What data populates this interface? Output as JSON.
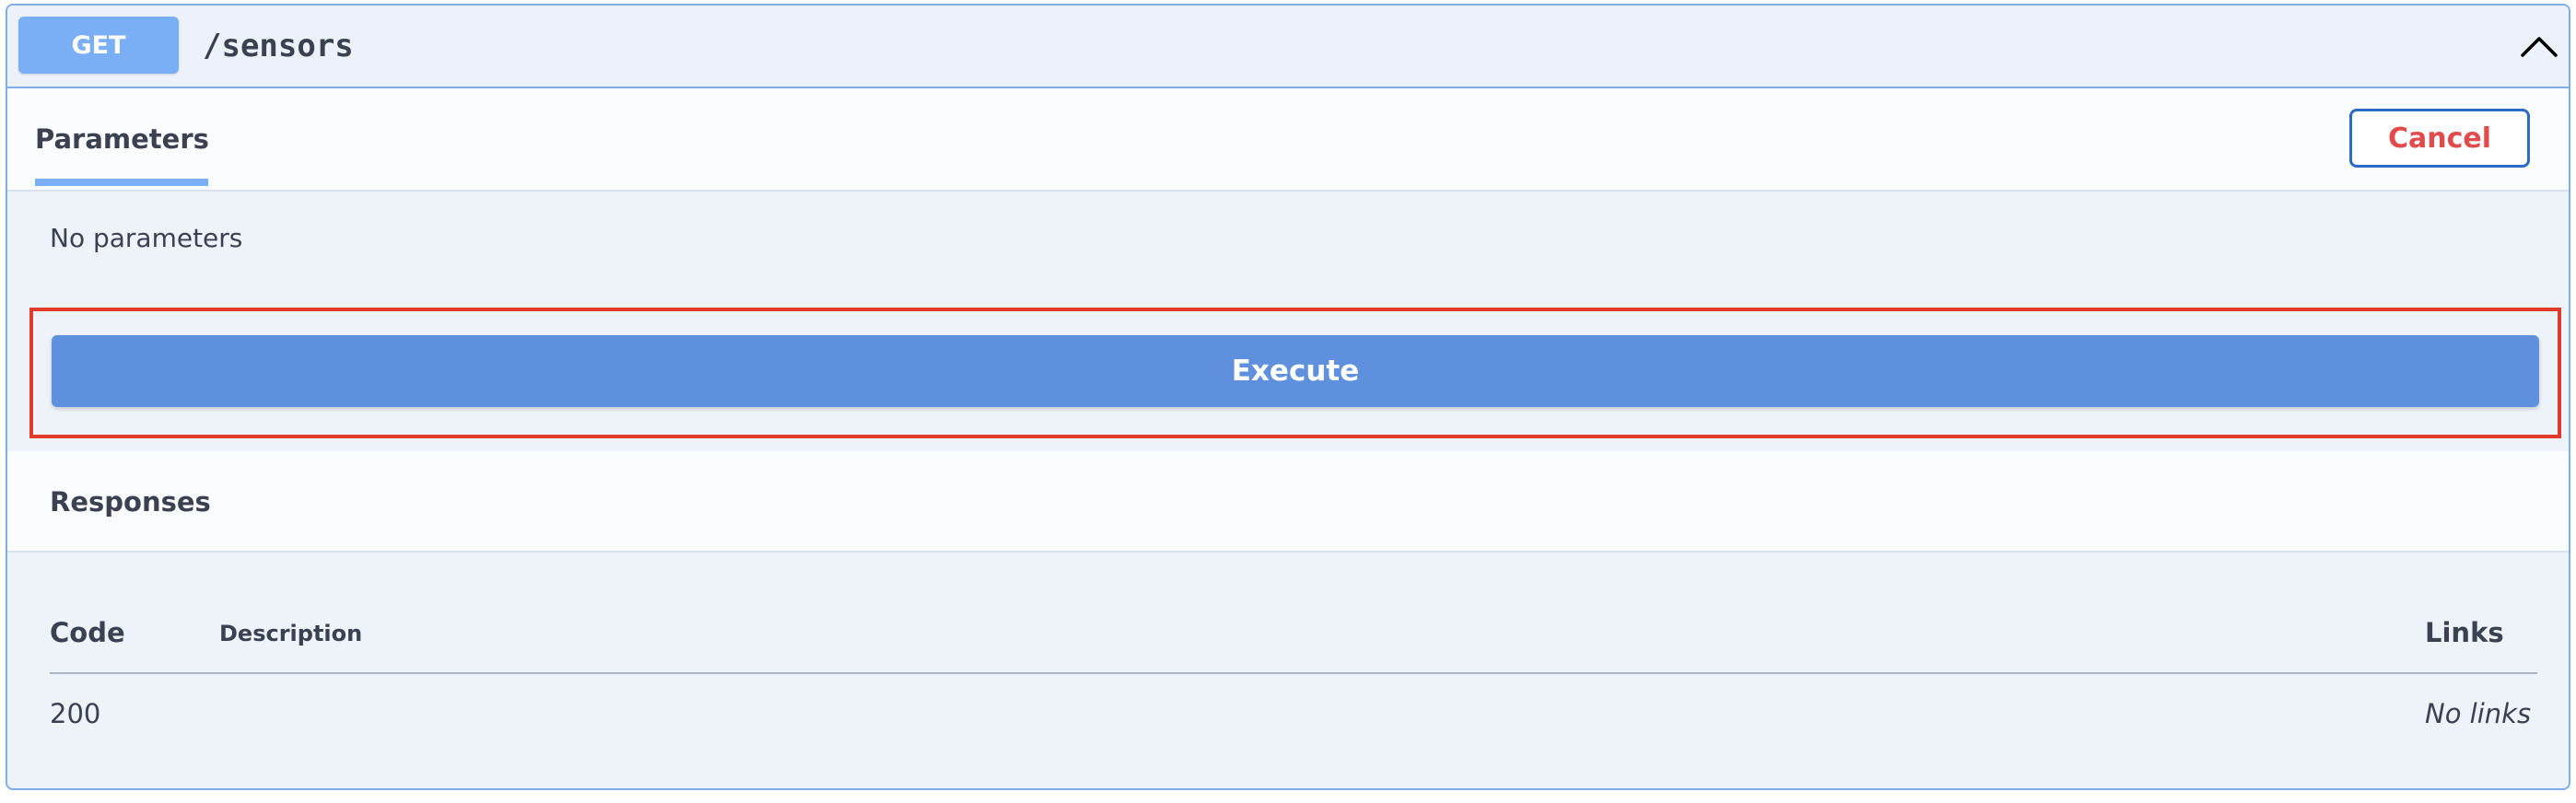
{
  "summary": {
    "method": "GET",
    "path": "/sensors",
    "chevron_icon": "chevron-up-icon"
  },
  "parameters": {
    "tab_label": "Parameters",
    "cancel_label": "Cancel",
    "empty_text": "No parameters"
  },
  "execute": {
    "label": "Execute"
  },
  "responses": {
    "title": "Responses",
    "columns": {
      "code": "Code",
      "description": "Description",
      "links": "Links"
    },
    "rows": [
      {
        "code": "200",
        "description": "",
        "links": "No links"
      }
    ]
  },
  "colors": {
    "method_badge": "#7aaff5",
    "execute_button": "#5e90dd",
    "cancel_text": "#e14b4b",
    "cancel_border": "#2d6bc9",
    "highlight_box": "#e03a2b",
    "block_border": "#7faee8"
  }
}
